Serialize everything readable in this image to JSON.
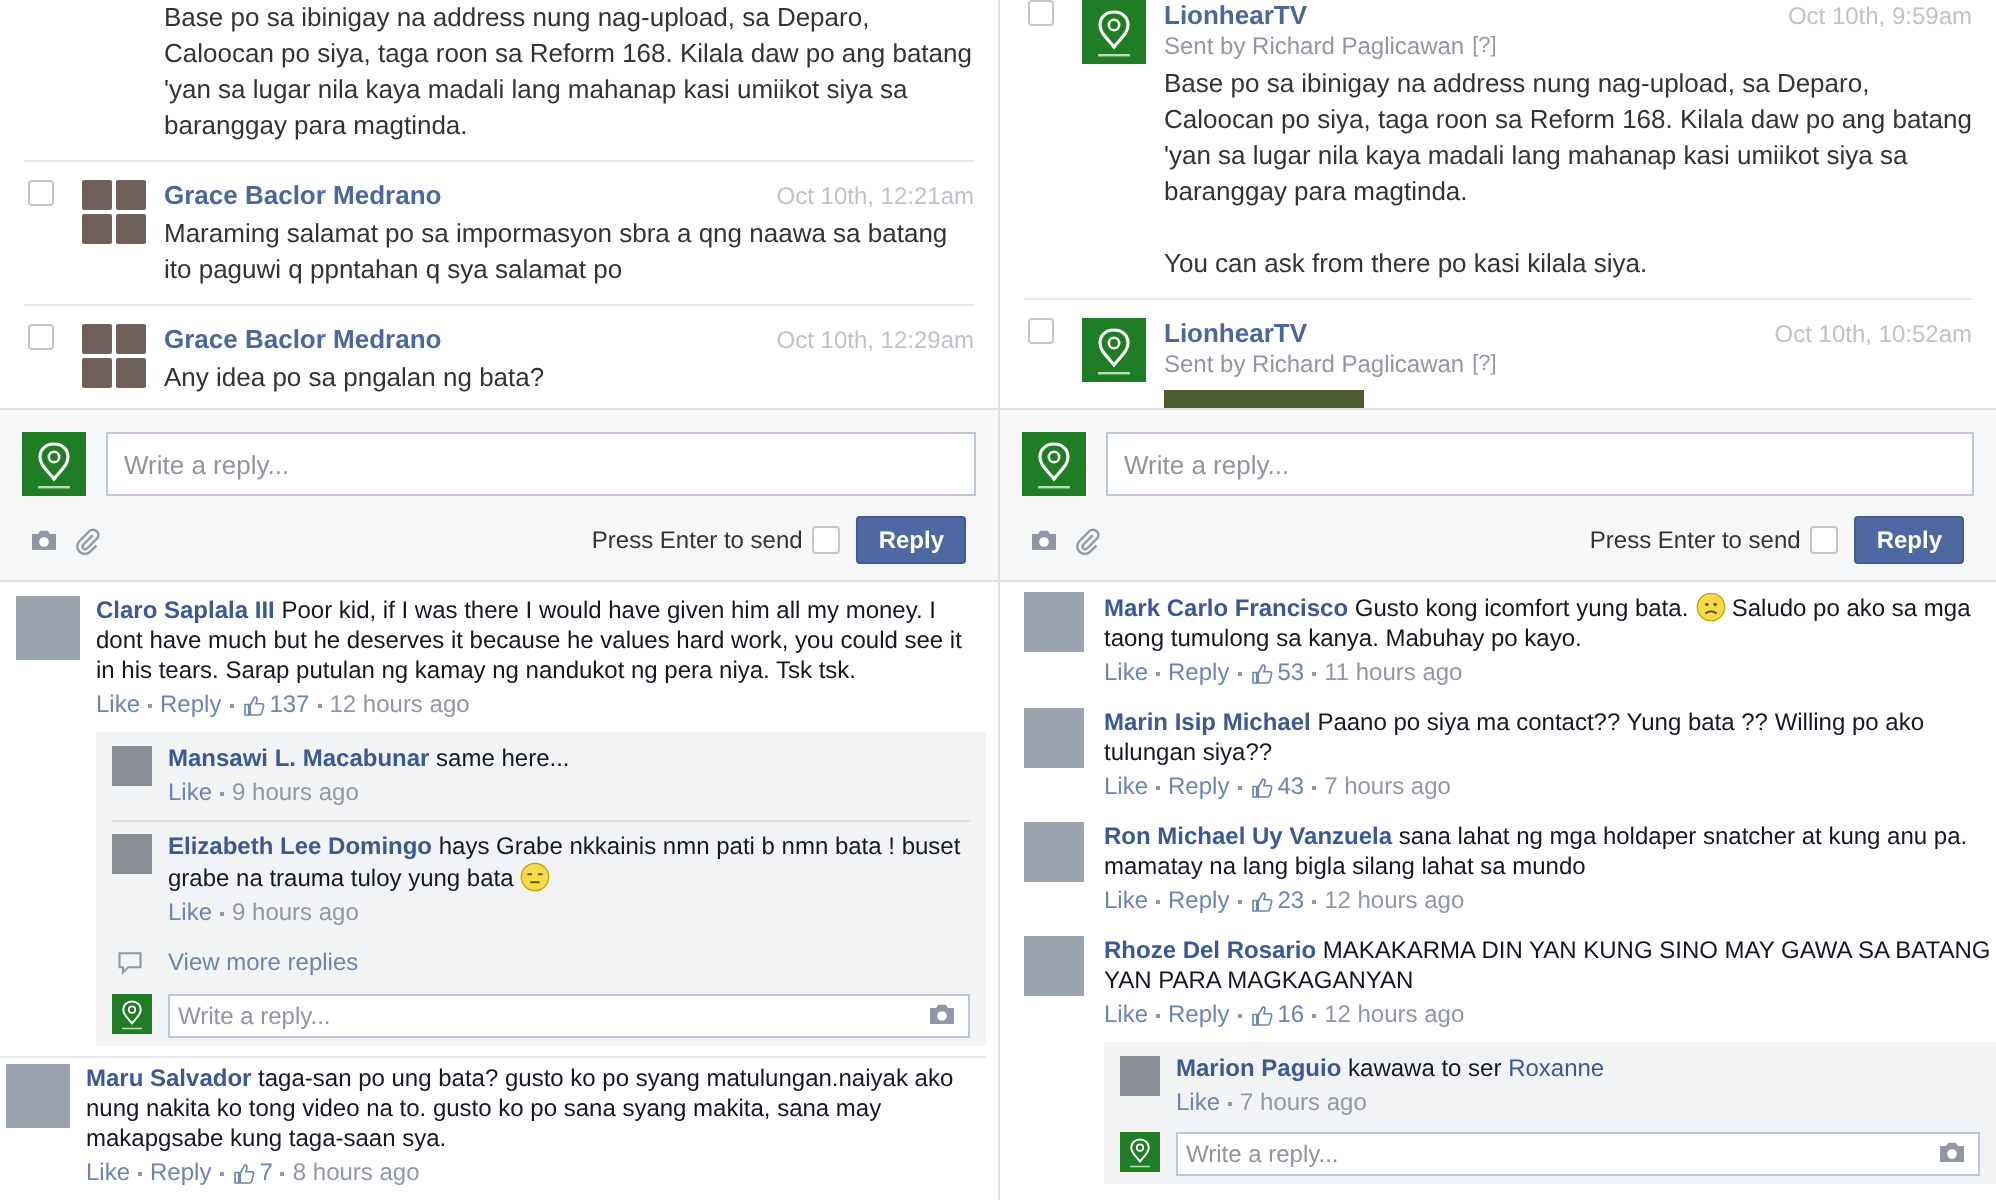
{
  "panels": [
    {
      "messages": [
        {
          "kind": "continuation",
          "paragraphs": [
            "Base po sa ibinigay na address nung nag-upload, sa Deparo, Caloocan po siya, taga roon sa Reform 168. Kilala daw po ang batang 'yan sa lugar nila kaya madali lang mahanap kasi umiikot siya sa baranggay para magtinda."
          ]
        },
        {
          "kind": "message",
          "checked": false,
          "avatar": {
            "kind": "collage"
          },
          "author": "Grace Baclor Medrano",
          "time": "Oct 10th, 12:21am",
          "paragraphs": [
            "Maraming salamat po sa impormasyon sbra a qng naawa sa batang ito paguwi q ppntahan q sya salamat po"
          ]
        },
        {
          "kind": "message",
          "checked": false,
          "avatar": {
            "kind": "collage"
          },
          "author": "Grace Baclor Medrano",
          "time": "Oct 10th, 12:29am",
          "paragraphs": [
            "Any idea po sa pngalan ng bata?"
          ]
        }
      ],
      "composer": {
        "placeholder": "Write a reply...",
        "enter_label": "Press Enter to send",
        "enter_checked": false,
        "button": "Reply"
      }
    },
    {
      "messages": [
        {
          "kind": "message",
          "checked": false,
          "avatar": {
            "kind": "page"
          },
          "author": "LionhearTV",
          "sender": "Sent by Richard Paglicawan",
          "help": "[?]",
          "time": "Oct 10th, 9:59am",
          "paragraphs": [
            "Base po sa ibinigay na address nung nag-upload, sa Deparo, Caloocan po siya, taga roon sa Reform 168. Kilala daw po ang batang 'yan sa lugar nila kaya madali lang mahanap kasi umiikot siya sa baranggay para magtinda.",
            "You can ask from there po kasi kilala siya."
          ]
        },
        {
          "kind": "message",
          "checked": false,
          "avatar": {
            "kind": "page"
          },
          "author": "LionhearTV",
          "sender": "Sent by Richard Paglicawan",
          "help": "[?]",
          "time": "Oct 10th, 10:52am",
          "photo": true
        }
      ],
      "composer": {
        "placeholder": "Write a reply...",
        "enter_label": "Press Enter to send",
        "enter_checked": false,
        "button": "Reply"
      }
    }
  ],
  "comment_columns": [
    {
      "comments": [
        {
          "avatar": {
            "kind": "person"
          },
          "author": "Claro Saplala III",
          "body": [
            {
              "kind": "text",
              "text": "Poor kid, if I was there I would have given him all my money. I dont have much but he deserves it because he values hard work, you could see it in his tears. Sarap putulan ng kamay ng nandukot ng pera niya. Tsk tsk."
            }
          ],
          "like": "Like",
          "reply": "Reply",
          "likes": "137",
          "time": "12 hours ago",
          "thread": {
            "replies": [
              {
                "author": "Mansawi L. Macabunar",
                "body": [
                  {
                    "kind": "text",
                    "text": "same here..."
                  }
                ],
                "like": "Like",
                "time": "9 hours ago"
              },
              {
                "author": "Elizabeth Lee Domingo",
                "body": [
                  {
                    "kind": "text",
                    "text": "hays Grabe nkkainis nmn pati b nmn bata ! buset grabe na trauma tuloy yung bata"
                  },
                  {
                    "kind": "emoticon-flat"
                  }
                ],
                "like": "Like",
                "time": "9 hours ago"
              }
            ],
            "more": "View more replies",
            "placeholder": "Write a reply..."
          }
        },
        {
          "avatar": {
            "kind": "person"
          },
          "author": "Maru Salvador",
          "body": [
            {
              "kind": "text",
              "text": "taga-san po ung bata? gusto ko po syang matulungan.naiyak ako nung nakita ko tong video na to. gusto ko po sana syang makita, sana may makapgsabe kung taga-saan sya."
            }
          ],
          "like": "Like",
          "reply": "Reply",
          "likes": "7",
          "time": "8 hours ago"
        }
      ]
    },
    {
      "comments": [
        {
          "avatar": {
            "kind": "person"
          },
          "author": "Mark Carlo Francisco",
          "body": [
            {
              "kind": "text",
              "text": "Gusto kong icomfort yung bata."
            },
            {
              "kind": "emoticon-frown"
            },
            {
              "kind": "text",
              "text": "Saludo po ako sa mga taong tumulong sa kanya. Mabuhay po kayo."
            }
          ],
          "like": "Like",
          "reply": "Reply",
          "likes": "53",
          "time": "11 hours ago"
        },
        {
          "avatar": {
            "kind": "person"
          },
          "author": "Marin Isip Michael",
          "body": [
            {
              "kind": "text",
              "text": "Paano po siya ma contact?? Yung bata ?? Willing po ako tulungan siya??"
            }
          ],
          "like": "Like",
          "reply": "Reply",
          "likes": "43",
          "time": "7 hours ago"
        },
        {
          "avatar": {
            "kind": "person"
          },
          "author": "Ron Michael Uy Vanzuela",
          "body": [
            {
              "kind": "text",
              "text": "sana lahat ng mga holdaper snatcher at kung anu pa. mamatay na lang bigla silang lahat sa mundo"
            }
          ],
          "like": "Like",
          "reply": "Reply",
          "likes": "23",
          "time": "12 hours ago"
        },
        {
          "avatar": {
            "kind": "person"
          },
          "author": "Rhoze Del Rosario",
          "body": [
            {
              "kind": "text",
              "text": "MAKAKARMA DIN YAN KUNG SINO MAY GAWA SA BATANG YAN PARA MAGKAGANYAN"
            }
          ],
          "like": "Like",
          "reply": "Reply",
          "likes": "16",
          "time": "12 hours ago",
          "thread": {
            "replies": [
              {
                "author": "Marion Paguio",
                "body": [
                  {
                    "kind": "text",
                    "text": "kawawa to ser"
                  },
                  {
                    "kind": "mention",
                    "text": "Roxanne"
                  }
                ],
                "like": "Like",
                "time": "7 hours ago"
              }
            ],
            "placeholder": "Write a reply..."
          }
        }
      ]
    }
  ]
}
